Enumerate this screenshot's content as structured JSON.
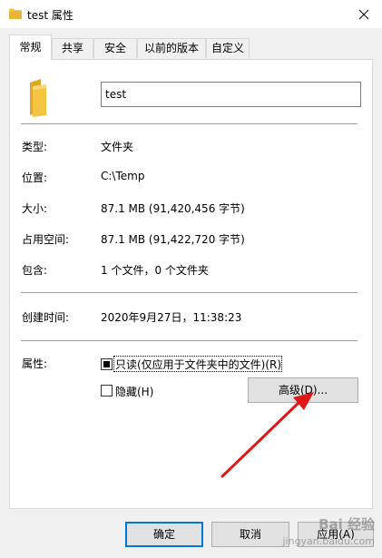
{
  "window": {
    "title": "test 属性",
    "close_symbol": "✕"
  },
  "tabs": [
    {
      "label": "常规",
      "active": true
    },
    {
      "label": "共享"
    },
    {
      "label": "安全"
    },
    {
      "label": "以前的版本"
    },
    {
      "label": "自定义"
    }
  ],
  "general": {
    "name_value": "test",
    "rows": [
      {
        "label": "类型:",
        "value": "文件夹"
      },
      {
        "label": "位置:",
        "value": "C:\\Temp"
      },
      {
        "label": "大小:",
        "value": "87.1 MB (91,420,456 字节)"
      },
      {
        "label": "占用空间:",
        "value": "87.1 MB (91,422,720 字节)"
      },
      {
        "label": "包含:",
        "value": "1 个文件，0 个文件夹"
      }
    ],
    "created_label": "创建时间:",
    "created_value": "2020年9月27日，11:38:23",
    "attributes_label": "属性:",
    "readonly": {
      "label": "只读(仅应用于文件夹中的文件)(R)",
      "checked": "indeterminate"
    },
    "hidden": {
      "label": "隐藏(H)",
      "checked": false
    },
    "advanced_label": "高级(D)..."
  },
  "buttons": {
    "ok": "确定",
    "cancel": "取消",
    "apply": "应用(A)"
  },
  "watermark": {
    "main": "Bai 经验",
    "sub": "jingyan.baidu.com"
  },
  "colors": {
    "folder": "#f5c542",
    "arrow": "#e01818",
    "primary_border": "#0078d7"
  },
  "icons": {
    "folder": "folder-icon",
    "close": "close-icon"
  }
}
